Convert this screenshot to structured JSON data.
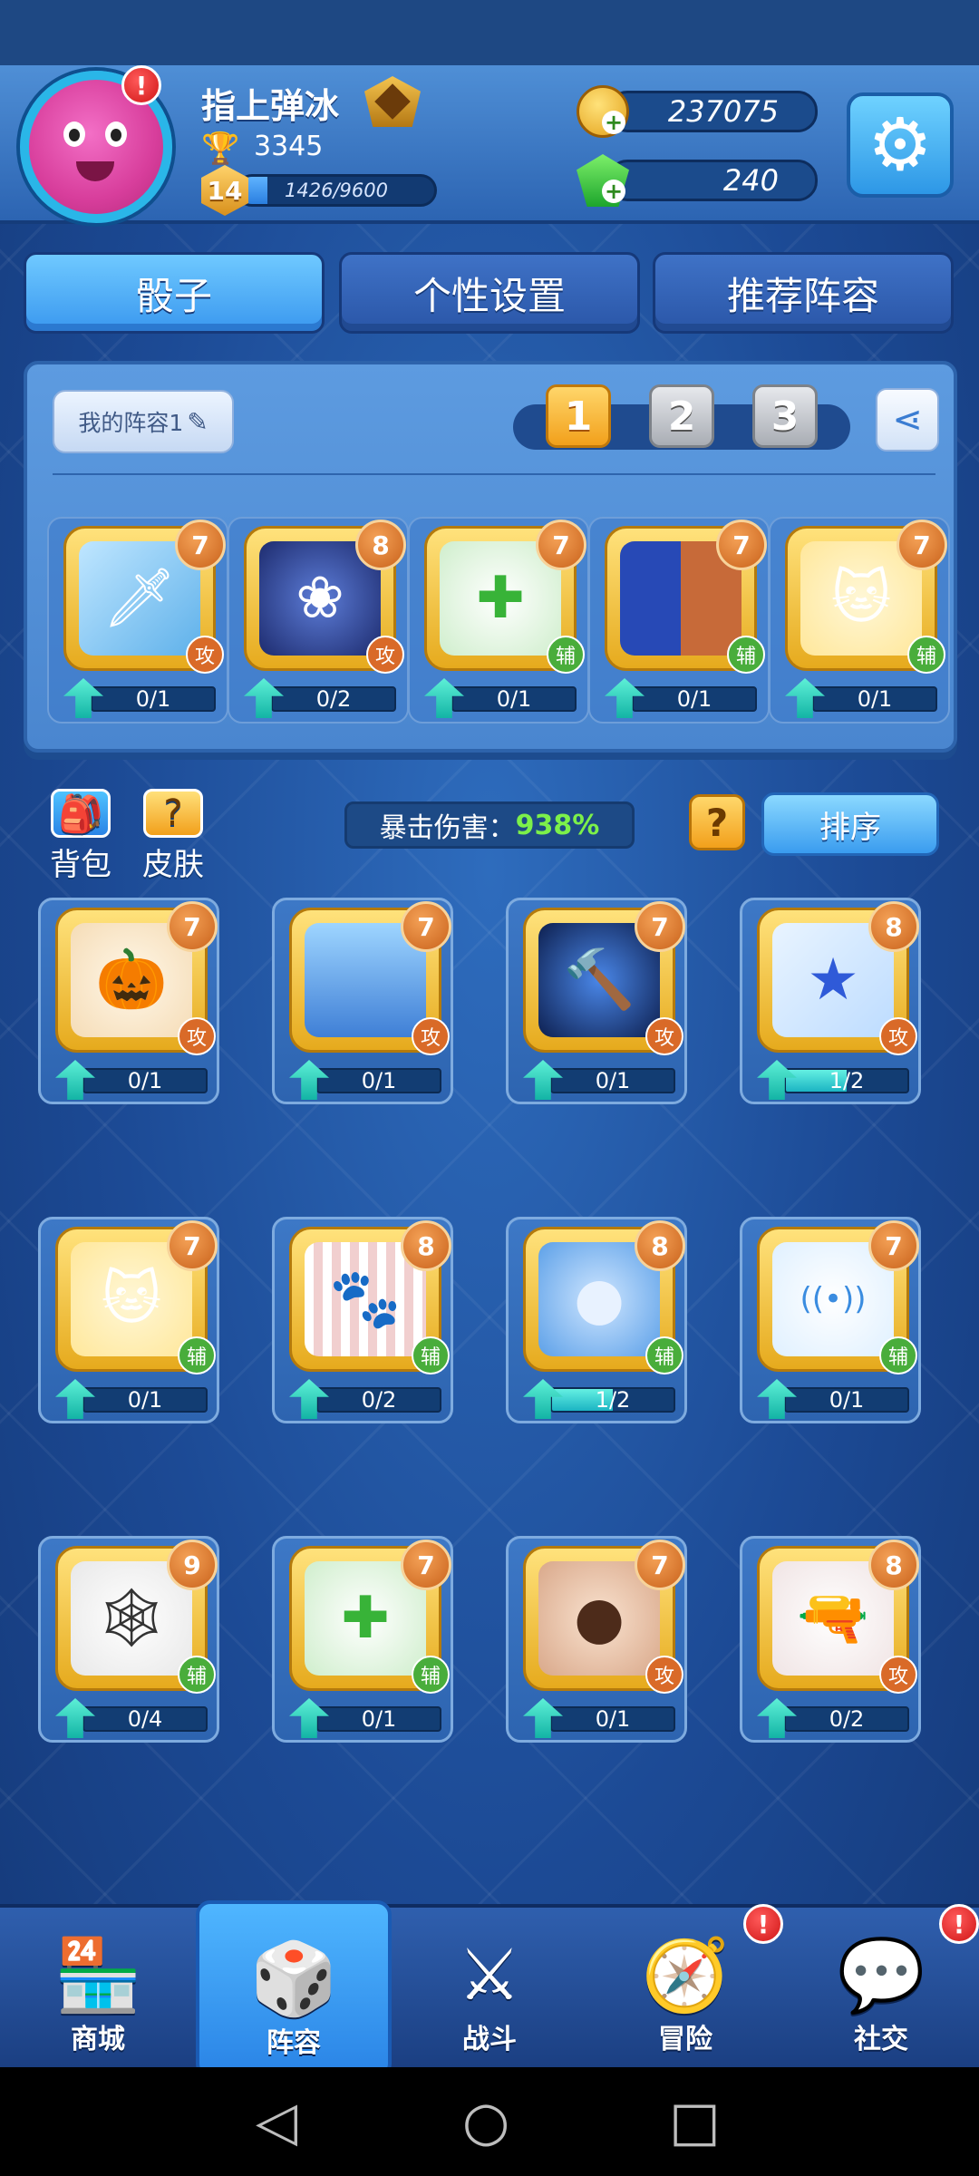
{
  "player": {
    "name": "指上弹冰",
    "trophies": "3345",
    "level": "14",
    "xp_text": "1426/9600",
    "xp_progress": 0.149
  },
  "currency": {
    "coins": "237075",
    "gems": "240"
  },
  "tabs": [
    "骰子",
    "个性设置",
    "推荐阵容"
  ],
  "deck": {
    "name": "我的阵容1",
    "slots": [
      "1",
      "2",
      "3"
    ],
    "active_slot": 1,
    "cards": [
      {
        "icon": "ice-sword-icon",
        "level": "7",
        "role": "攻",
        "progress_text": "0/1",
        "progress": 0
      },
      {
        "icon": "lotus-icon",
        "level": "8",
        "role": "攻",
        "progress_text": "0/2",
        "progress": 0
      },
      {
        "icon": "heal-cross-icon",
        "level": "7",
        "role": "辅",
        "progress_text": "0/1",
        "progress": 0
      },
      {
        "icon": "paint-figure-icon",
        "level": "7",
        "role": "辅",
        "progress_text": "0/1",
        "progress": 0
      },
      {
        "icon": "lucky-cat-icon",
        "level": "7",
        "role": "辅",
        "progress_text": "0/1",
        "progress": 0
      }
    ]
  },
  "side": {
    "bag_label": "背包",
    "skin_label": "皮肤"
  },
  "crit": {
    "label": "暴击伤害：",
    "value": "938%"
  },
  "sort_label": "排序",
  "collection": [
    {
      "icon": "pumpkin-witch-icon",
      "level": "7",
      "role": "攻",
      "progress_text": "0/1",
      "progress": 0
    },
    {
      "icon": "moon-lady-icon",
      "level": "7",
      "role": "攻",
      "progress_text": "0/1",
      "progress": 0
    },
    {
      "icon": "thunder-hammer-icon",
      "level": "7",
      "role": "攻",
      "progress_text": "0/1",
      "progress": 0
    },
    {
      "icon": "star-icon",
      "level": "8",
      "role": "攻",
      "progress_text": "1/2",
      "progress": 0.5
    },
    {
      "icon": "lucky-cat-icon",
      "level": "7",
      "role": "辅",
      "progress_text": "0/1",
      "progress": 0
    },
    {
      "icon": "paw-icon",
      "level": "8",
      "role": "辅",
      "progress_text": "0/2",
      "progress": 0
    },
    {
      "icon": "moon-icon",
      "level": "8",
      "role": "辅",
      "progress_text": "1/2",
      "progress": 0.5
    },
    {
      "icon": "signal-icon",
      "level": "7",
      "role": "辅",
      "progress_text": "0/1",
      "progress": 0
    },
    {
      "icon": "spider-web-icon",
      "level": "9",
      "role": "辅",
      "progress_text": "0/4",
      "progress": 0
    },
    {
      "icon": "heal-cross-icon",
      "level": "7",
      "role": "辅",
      "progress_text": "0/1",
      "progress": 0
    },
    {
      "icon": "hair-icon",
      "level": "7",
      "role": "攻",
      "progress_text": "0/1",
      "progress": 0
    },
    {
      "icon": "revolver-icon",
      "level": "8",
      "role": "攻",
      "progress_text": "0/2",
      "progress": 0
    }
  ],
  "nav": [
    "商城",
    "阵容",
    "战斗",
    "冒险",
    "社交"
  ],
  "nav_active": 1,
  "alert_mark": "!",
  "colors": {
    "accent": "#3a98ef",
    "gold": "#f2a01b",
    "crit_value": "#7cf04a",
    "attack": "#d96a28",
    "support": "#49ad3b"
  }
}
